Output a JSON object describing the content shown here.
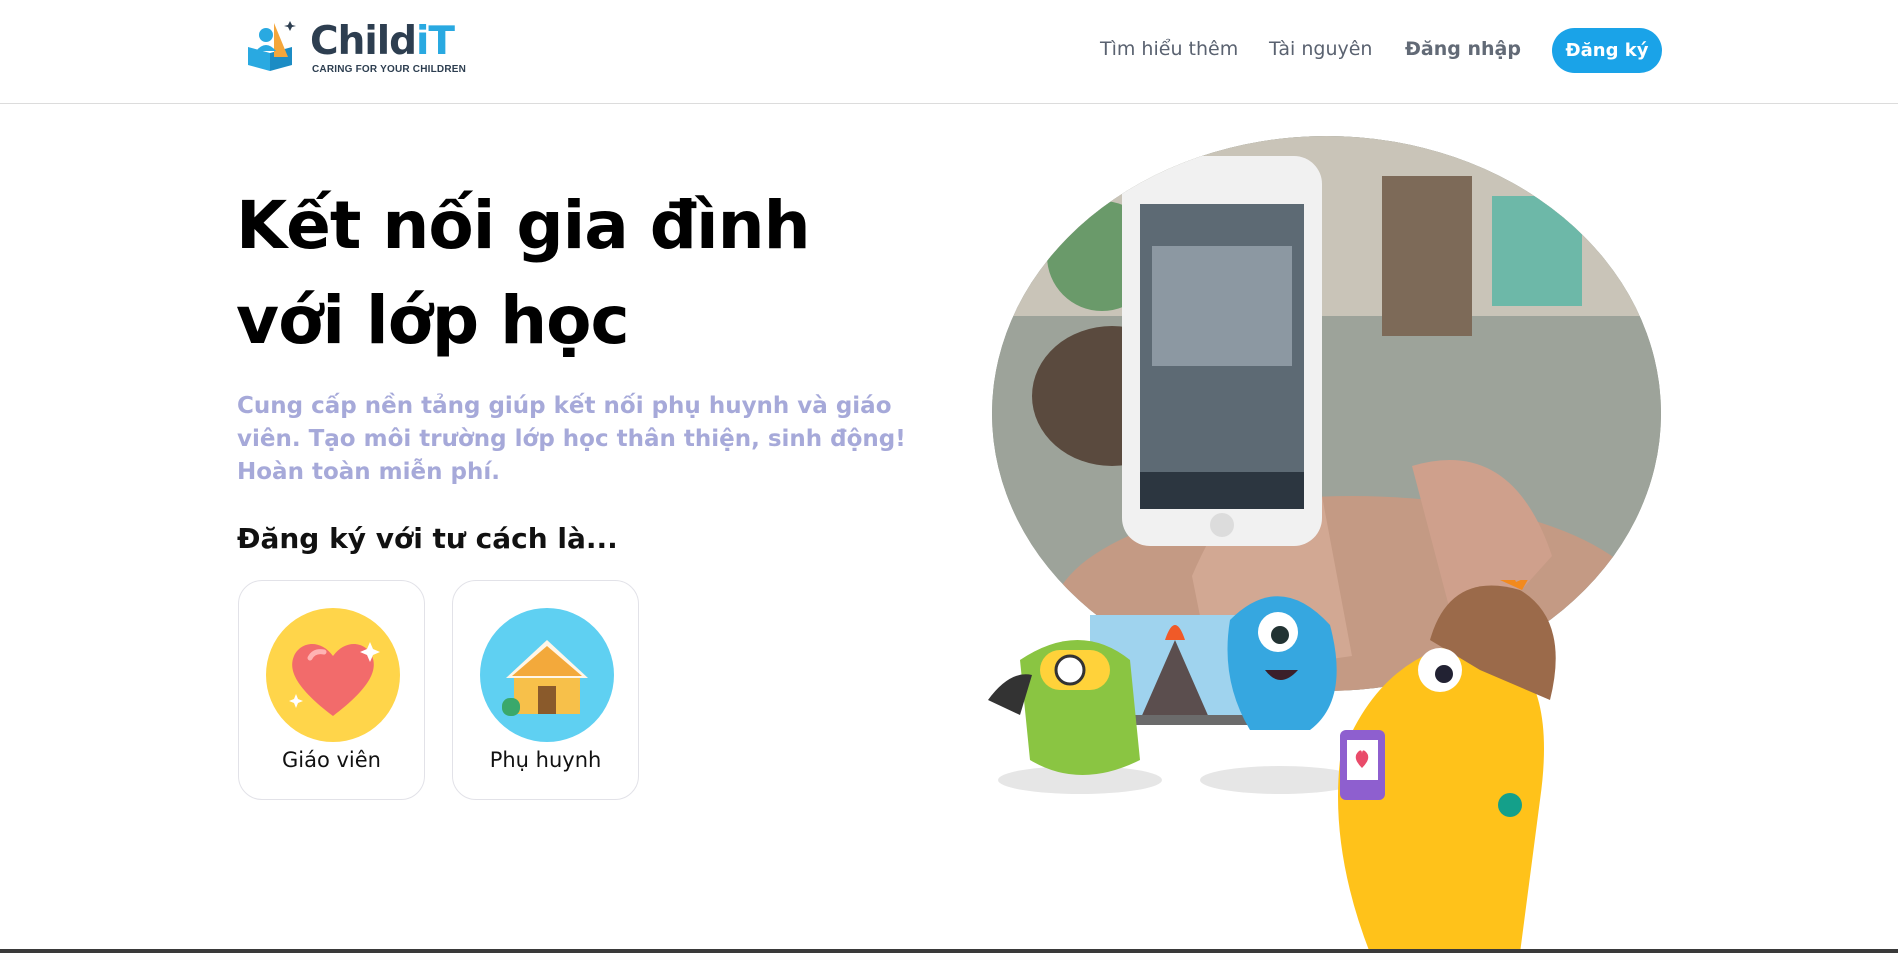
{
  "brand": {
    "name_main": "Child",
    "name_accent": "iT",
    "tagline": "CARING FOR YOUR CHILDREN",
    "logo_icon": "reading-child-logo-icon"
  },
  "nav": {
    "learn_more": "Tìm hiểu thêm",
    "resources": "Tài nguyên",
    "login": "Đăng nhập",
    "signup": "Đăng ký"
  },
  "hero": {
    "title_line1": "Kết nối gia đình",
    "title_line2": "với lớp học",
    "subtitle": "Cung cấp nền tảng giúp kết nối phụ huynh và giáo viên. Tạo môi trường lớp học thân thiện, sinh động! Hoàn toàn miễn phí.",
    "role_heading": "Đăng ký với tư cách là..."
  },
  "roles": [
    {
      "label": "Giáo viên",
      "icon": "heart-icon",
      "color": "#ffd54a"
    },
    {
      "label": "Phụ huynh",
      "icon": "house-icon",
      "color": "#5fd0f2"
    }
  ],
  "colors": {
    "accent": "#1aa3e8",
    "subtitle": "#a6a9d9",
    "brand_dark": "#2d3e50"
  }
}
